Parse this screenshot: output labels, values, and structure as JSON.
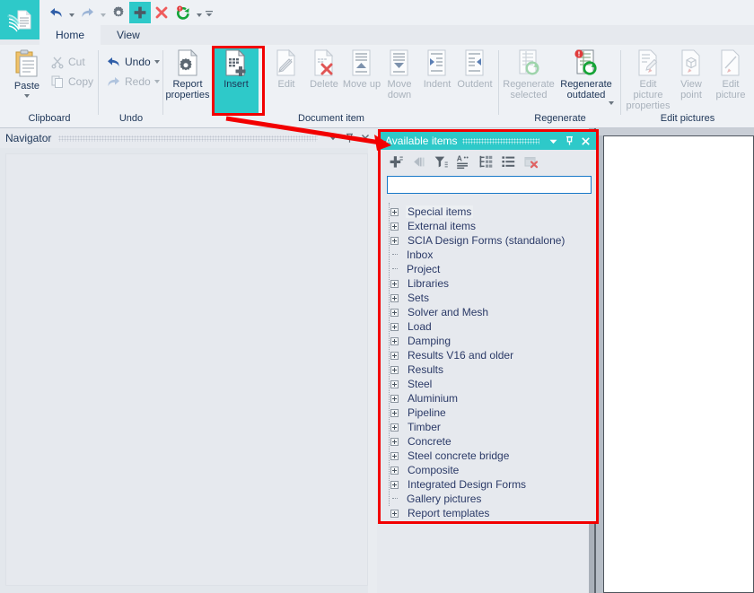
{
  "window": {
    "app_logo_icon": "scia-document-logo-icon"
  },
  "quick_access": {
    "items": [
      {
        "name": "undo",
        "icon": "undo-arrow-icon",
        "enabled": true,
        "has_caret": true
      },
      {
        "name": "redo",
        "icon": "redo-arrow-icon",
        "enabled": false,
        "has_caret": true
      },
      {
        "name": "report-properties",
        "icon": "gear-icon",
        "enabled": true,
        "has_caret": false
      },
      {
        "name": "insert",
        "icon": "plus-icon",
        "enabled": true,
        "selected": true,
        "has_caret": false
      },
      {
        "name": "delete",
        "icon": "red-cross-icon",
        "enabled": true,
        "has_caret": false
      },
      {
        "name": "regenerate",
        "icon": "regenerate-warning-icon",
        "enabled": true,
        "has_caret": true
      },
      {
        "name": "customize-quick-access",
        "icon": "overflow-caret-icon",
        "enabled": true,
        "has_caret": false
      }
    ]
  },
  "tabs": [
    {
      "label": "Home",
      "active": true
    },
    {
      "label": "View",
      "active": false
    }
  ],
  "ribbon": {
    "groups": [
      {
        "title": "Clipboard",
        "big_buttons": [
          {
            "label": "Paste",
            "icon": "paste-clipboard-icon",
            "enabled": true,
            "has_caret": true
          }
        ],
        "small_buttons": [
          {
            "label": "Cut",
            "icon": "scissors-icon",
            "enabled": false
          },
          {
            "label": "Copy",
            "icon": "copy-pages-icon",
            "enabled": false
          }
        ]
      },
      {
        "title": "Undo",
        "small_buttons": [
          {
            "label": "Undo",
            "icon": "undo-arrow-icon",
            "enabled": true,
            "has_caret": true
          },
          {
            "label": "Redo",
            "icon": "redo-arrow-icon",
            "enabled": false,
            "has_caret": true
          }
        ]
      },
      {
        "title": "Document item",
        "big_buttons": [
          {
            "label": "Report properties",
            "icon": "report-properties-icon",
            "enabled": true
          },
          {
            "label": "Insert",
            "icon": "insert-item-icon",
            "enabled": true,
            "highlighted": true
          },
          {
            "label": "Edit",
            "icon": "edit-item-icon",
            "enabled": false
          },
          {
            "label": "Delete",
            "icon": "delete-item-icon",
            "enabled": false
          },
          {
            "label": "Move up",
            "icon": "move-up-icon",
            "enabled": false
          },
          {
            "label": "Move down",
            "icon": "move-down-icon",
            "enabled": false
          },
          {
            "label": "Indent",
            "icon": "indent-icon",
            "enabled": false
          },
          {
            "label": "Outdent",
            "icon": "outdent-icon",
            "enabled": false
          }
        ]
      },
      {
        "title": "Regenerate",
        "big_buttons": [
          {
            "label": "Regenerate selected",
            "icon": "regenerate-selected-icon",
            "enabled": false
          },
          {
            "label": "Regenerate outdated",
            "icon": "regenerate-outdated-icon",
            "enabled": true,
            "has_caret": true
          }
        ]
      },
      {
        "title": "Edit pictures",
        "big_buttons": [
          {
            "label": "Edit picture properties",
            "icon": "edit-picture-properties-icon",
            "enabled": false
          },
          {
            "label": "View point",
            "icon": "view-point-icon",
            "enabled": false
          },
          {
            "label": "Edit picture",
            "icon": "edit-picture-icon",
            "enabled": false
          }
        ]
      }
    ]
  },
  "navigator": {
    "title": "Navigator",
    "header_buttons": [
      {
        "name": "dropdown",
        "icon": "chevron-down-icon"
      },
      {
        "name": "pin",
        "icon": "pin-icon"
      },
      {
        "name": "close",
        "icon": "close-icon"
      }
    ]
  },
  "available_items_panel": {
    "title": "Available items",
    "title_buttons": [
      {
        "name": "dropdown",
        "icon": "chevron-down-icon"
      },
      {
        "name": "pin",
        "icon": "pin-icon"
      },
      {
        "name": "close",
        "icon": "close-icon"
      }
    ],
    "toolbar": [
      {
        "name": "insert-item",
        "icon": "insert-plus-icon",
        "enabled": true
      },
      {
        "name": "insert-into-report",
        "icon": "arrow-left-insert-icon",
        "enabled": false
      },
      {
        "name": "filter",
        "icon": "filter-icon",
        "enabled": true
      },
      {
        "name": "sort-alphabetically",
        "icon": "sort-az-icon",
        "enabled": true
      },
      {
        "name": "group-tree",
        "icon": "tree-structure-icon",
        "enabled": true
      },
      {
        "name": "list-view",
        "icon": "list-view-icon",
        "enabled": true
      },
      {
        "name": "delete-item",
        "icon": "delete-box-icon",
        "enabled": false
      }
    ],
    "search": {
      "value": "",
      "placeholder": "",
      "focused": true
    },
    "tree": [
      {
        "label": "Special items",
        "expandable": true,
        "highlighted": true
      },
      {
        "label": "External items",
        "expandable": true
      },
      {
        "label": "SCIA Design Forms (standalone)",
        "expandable": true
      },
      {
        "label": "Inbox",
        "expandable": false
      },
      {
        "label": "Project",
        "expandable": false
      },
      {
        "label": "Libraries",
        "expandable": true
      },
      {
        "label": "Sets",
        "expandable": true
      },
      {
        "label": "Solver and Mesh",
        "expandable": true
      },
      {
        "label": "Load",
        "expandable": true
      },
      {
        "label": "Damping",
        "expandable": true
      },
      {
        "label": "Results V16 and older",
        "expandable": true
      },
      {
        "label": "Results",
        "expandable": true
      },
      {
        "label": "Steel",
        "expandable": true
      },
      {
        "label": "Aluminium",
        "expandable": true
      },
      {
        "label": "Pipeline",
        "expandable": true
      },
      {
        "label": "Timber",
        "expandable": true
      },
      {
        "label": "Concrete",
        "expandable": true
      },
      {
        "label": "Steel concrete bridge",
        "expandable": true
      },
      {
        "label": "Composite",
        "expandable": true
      },
      {
        "label": "Integrated Design Forms",
        "expandable": true
      },
      {
        "label": "Gallery pictures",
        "expandable": false
      },
      {
        "label": "Report templates",
        "expandable": true
      }
    ]
  },
  "annotations": {
    "highlight_color": "#f20000",
    "accent_color": "#2ec9c9",
    "boxes": [
      {
        "name": "insert-button-highlight"
      },
      {
        "name": "available-items-panel-highlight"
      }
    ],
    "arrow": {
      "name": "insert-to-panel-arrow",
      "color": "#f20000"
    }
  }
}
